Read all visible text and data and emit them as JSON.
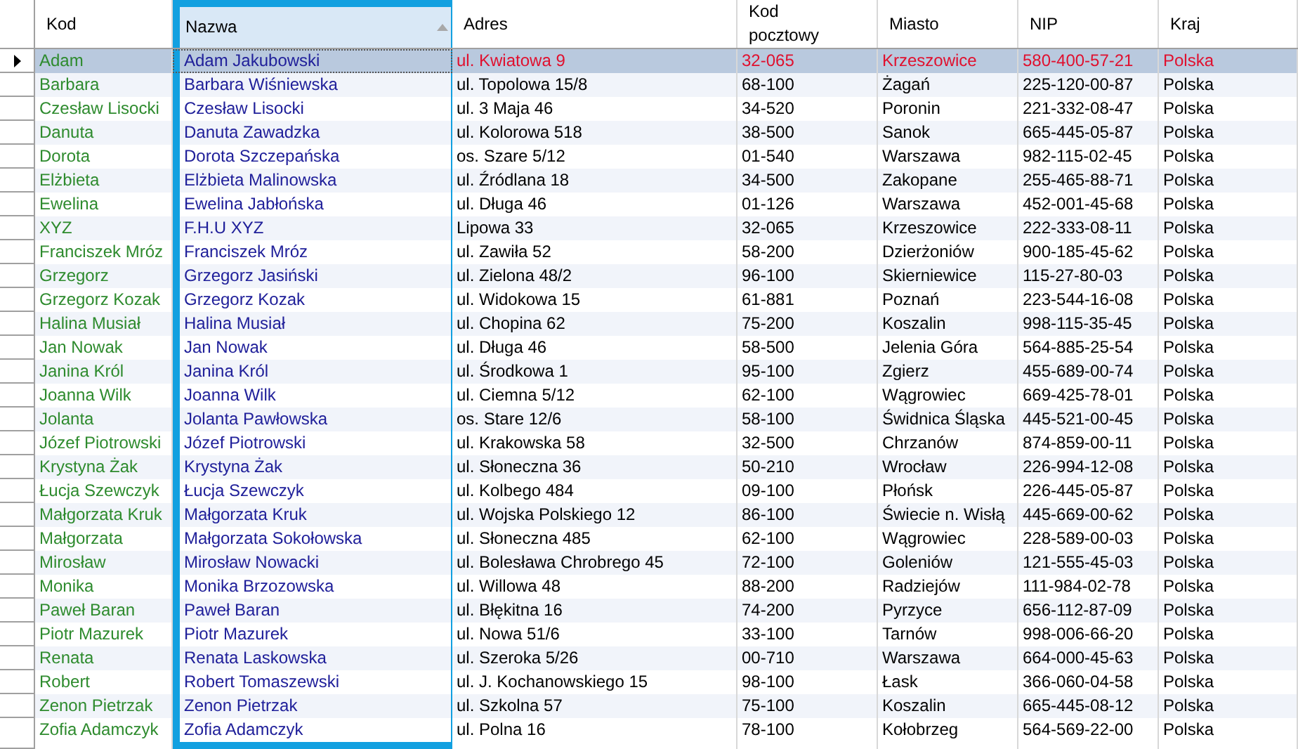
{
  "table": {
    "columns": [
      {
        "label": "Kod",
        "color": "#2e8b2e",
        "highlighted": false,
        "sorted": false
      },
      {
        "label": "Nazwa",
        "color": "#20209a",
        "highlighted": true,
        "sorted": true
      },
      {
        "label": "Adres",
        "color": "#000000",
        "highlighted": false,
        "sorted": false
      },
      {
        "label": "Kod pocztowy",
        "color": "#000000",
        "highlighted": false,
        "sorted": false
      },
      {
        "label": "Miasto",
        "color": "#000000",
        "highlighted": false,
        "sorted": false
      },
      {
        "label": "NIP",
        "color": "#000000",
        "highlighted": false,
        "sorted": false
      },
      {
        "label": "Kraj",
        "color": "#000000",
        "highlighted": false,
        "sorted": false
      }
    ],
    "rows": [
      {
        "selected": true,
        "cells": [
          "Adam",
          "Adam Jakubowski",
          "ul. Kwiatowa 9",
          "32-065",
          "Krzeszowice",
          "580-400-57-21",
          "Polska"
        ]
      },
      {
        "selected": false,
        "cells": [
          "Barbara",
          "Barbara Wiśniewska",
          "ul. Topolowa 15/8",
          "68-100",
          "Żagań",
          "225-120-00-87",
          "Polska"
        ]
      },
      {
        "selected": false,
        "cells": [
          "Czesław Lisocki",
          "Czesław Lisocki",
          "ul. 3 Maja 46",
          "34-520",
          "Poronin",
          "221-332-08-47",
          "Polska"
        ]
      },
      {
        "selected": false,
        "cells": [
          "Danuta",
          "Danuta Zawadzka",
          "ul. Kolorowa 518",
          "38-500",
          "Sanok",
          "665-445-05-87",
          "Polska"
        ]
      },
      {
        "selected": false,
        "cells": [
          "Dorota",
          "Dorota Szczepańska",
          "os. Szare 5/12",
          "01-540",
          "Warszawa",
          "982-115-02-45",
          "Polska"
        ]
      },
      {
        "selected": false,
        "cells": [
          "Elżbieta",
          "Elżbieta Malinowska",
          "ul. Źródlana 18",
          "34-500",
          "Zakopane",
          "255-465-88-71",
          "Polska"
        ]
      },
      {
        "selected": false,
        "cells": [
          "Ewelina",
          "Ewelina Jabłońska",
          "ul. Długa 46",
          "01-126",
          "Warszawa",
          "452-001-45-68",
          "Polska"
        ]
      },
      {
        "selected": false,
        "cells": [
          "XYZ",
          "F.H.U XYZ",
          "Lipowa 33",
          "32-065",
          "Krzeszowice",
          "222-333-08-11",
          "Polska"
        ]
      },
      {
        "selected": false,
        "cells": [
          "Franciszek Mróz",
          "Franciszek Mróz",
          "ul. Zawiła 52",
          "58-200",
          "Dzierżoniów",
          "900-185-45-62",
          "Polska"
        ]
      },
      {
        "selected": false,
        "cells": [
          "Grzegorz",
          "Grzegorz Jasiński",
          "ul. Zielona 48/2",
          "96-100",
          "Skierniewice",
          "115-27-80-03",
          "Polska"
        ]
      },
      {
        "selected": false,
        "cells": [
          "Grzegorz Kozak",
          "Grzegorz Kozak",
          "ul. Widokowa 15",
          "61-881",
          "Poznań",
          "223-544-16-08",
          "Polska"
        ]
      },
      {
        "selected": false,
        "cells": [
          "Halina Musiał",
          "Halina Musiał",
          "ul. Chopina 62",
          "75-200",
          "Koszalin",
          "998-115-35-45",
          "Polska"
        ]
      },
      {
        "selected": false,
        "cells": [
          "Jan Nowak",
          "Jan Nowak",
          "ul. Długa 46",
          "58-500",
          "Jelenia Góra",
          "564-885-25-54",
          "Polska"
        ]
      },
      {
        "selected": false,
        "cells": [
          "Janina Król",
          "Janina Król",
          "ul. Środkowa 1",
          "95-100",
          "Zgierz",
          "455-689-00-74",
          "Polska"
        ]
      },
      {
        "selected": false,
        "cells": [
          "Joanna Wilk",
          "Joanna Wilk",
          "ul. Ciemna 5/12",
          "62-100",
          "Wągrowiec",
          "669-425-78-01",
          "Polska"
        ]
      },
      {
        "selected": false,
        "cells": [
          "Jolanta",
          "Jolanta Pawłowska",
          "os. Stare 12/6",
          "58-100",
          "Świdnica Śląska",
          "445-521-00-45",
          "Polska"
        ]
      },
      {
        "selected": false,
        "cells": [
          "Józef Piotrowski",
          "Józef Piotrowski",
          "ul. Krakowska 58",
          "32-500",
          "Chrzanów",
          "874-859-00-11",
          "Polska"
        ]
      },
      {
        "selected": false,
        "cells": [
          "Krystyna Żak",
          "Krystyna Żak",
          "ul. Słoneczna 36",
          "50-210",
          "Wrocław",
          "226-994-12-08",
          "Polska"
        ]
      },
      {
        "selected": false,
        "cells": [
          "Łucja Szewczyk",
          "Łucja Szewczyk",
          "ul. Kolbego 484",
          "09-100",
          "Płońsk",
          "226-445-05-87",
          "Polska"
        ]
      },
      {
        "selected": false,
        "cells": [
          "Małgorzata Kruk",
          "Małgorzata Kruk",
          "ul. Wojska Polskiego 12",
          "86-100",
          "Świecie n. Wisłą",
          "445-669-00-62",
          "Polska"
        ]
      },
      {
        "selected": false,
        "cells": [
          "Małgorzata",
          "Małgorzata Sokołowska",
          "ul. Słoneczna 485",
          "62-100",
          "Wągrowiec",
          "228-589-00-03",
          "Polska"
        ]
      },
      {
        "selected": false,
        "cells": [
          "Mirosław",
          "Mirosław Nowacki",
          "ul. Bolesława Chrobrego 45",
          "72-100",
          "Goleniów",
          "121-555-45-03",
          "Polska"
        ]
      },
      {
        "selected": false,
        "cells": [
          "Monika",
          "Monika Brzozowska",
          "ul. Willowa 48",
          "88-200",
          "Radziejów",
          "111-984-02-78",
          "Polska"
        ]
      },
      {
        "selected": false,
        "cells": [
          "Paweł Baran",
          "Paweł Baran",
          "ul. Błękitna 16",
          "74-200",
          "Pyrzyce",
          "656-112-87-09",
          "Polska"
        ]
      },
      {
        "selected": false,
        "cells": [
          "Piotr Mazurek",
          "Piotr Mazurek",
          "ul. Nowa 51/6",
          "33-100",
          "Tarnów",
          "998-006-66-20",
          "Polska"
        ]
      },
      {
        "selected": false,
        "cells": [
          "Renata",
          "Renata Laskowska",
          "ul. Szeroka 5/26",
          "00-710",
          "Warszawa",
          "664-000-45-63",
          "Polska"
        ]
      },
      {
        "selected": false,
        "cells": [
          "Robert",
          "Robert Tomaszewski",
          "ul. J. Kochanowskiego 15",
          "98-100",
          "Łask",
          "366-060-04-58",
          "Polska"
        ]
      },
      {
        "selected": false,
        "cells": [
          "Zenon Pietrzak",
          "Zenon Pietrzak",
          "ul. Szkolna 57",
          "75-100",
          "Koszalin",
          "665-445-08-12",
          "Polska"
        ]
      },
      {
        "selected": false,
        "cells": [
          "Zofia Adamczyk",
          "Zofia Adamczyk",
          "ul. Polna 16",
          "78-100",
          "Kołobrzeg",
          "564-569-22-00",
          "Polska"
        ]
      }
    ]
  }
}
